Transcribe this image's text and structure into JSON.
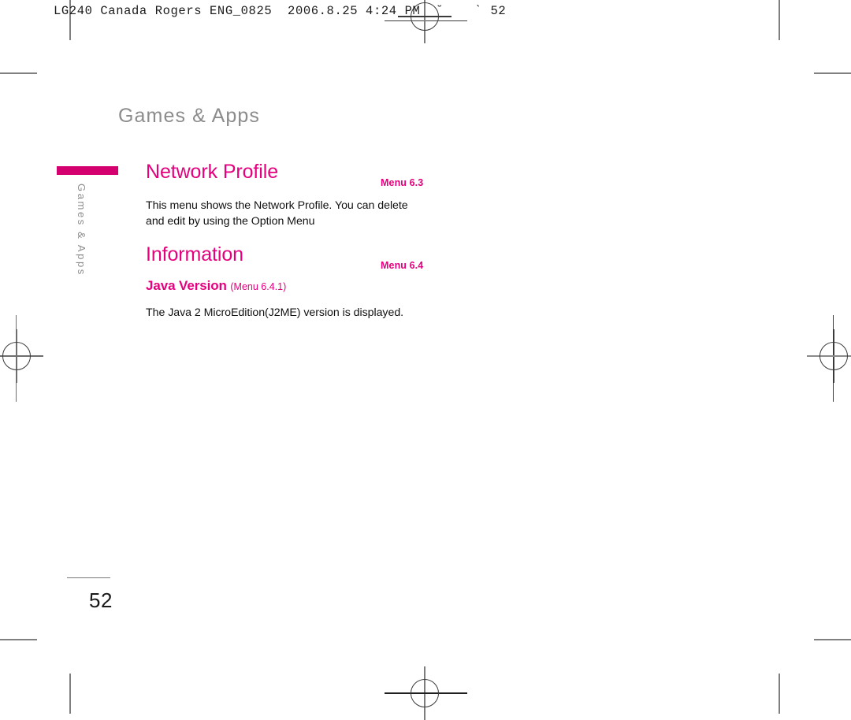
{
  "prepress": {
    "header_line": "LG240 Canada Rogers ENG_0825  2006.8.25 4:24 PM  ˘    ˋ 52",
    "registration_marks": [
      "top-mark",
      "left-mark",
      "right-mark",
      "bottom-mark"
    ]
  },
  "page": {
    "header": "Games & Apps",
    "tab_label": "Games & Apps",
    "number": "52",
    "accent_color": "#e5007d",
    "tab_bar_color": "#d4006f",
    "header_color": "#8c8c8c"
  },
  "sections": [
    {
      "title": "Network Profile",
      "menu_ref": "Menu 6.3",
      "body": "This menu shows the Network Profile. You can delete and edit by using the Option Menu"
    },
    {
      "title": "Information",
      "menu_ref": "Menu 6.4",
      "sub_title": "Java Version",
      "sub_ref": "(Menu 6.4.1)",
      "body": "The Java 2 MicroEdition(J2ME) version is displayed."
    }
  ]
}
